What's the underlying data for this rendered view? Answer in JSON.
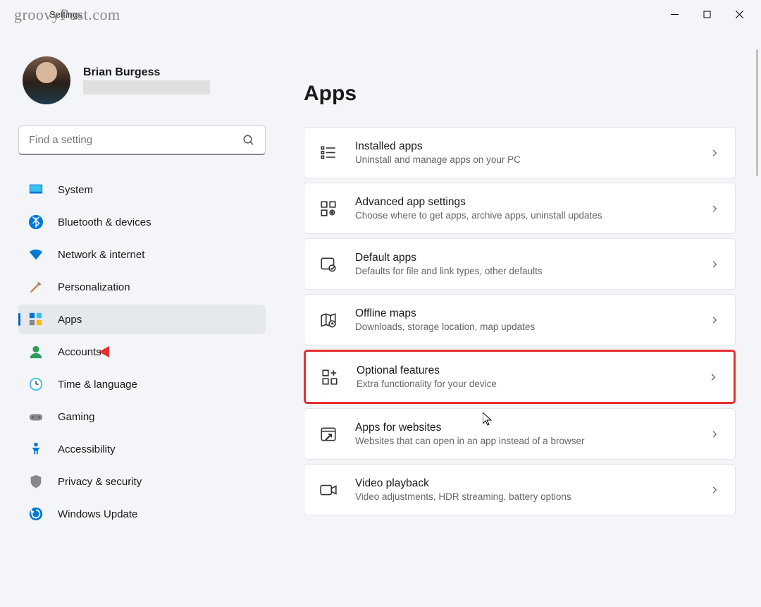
{
  "watermark": "groovyPost.com",
  "window": {
    "title": "Settings"
  },
  "profile": {
    "name": "Brian Burgess"
  },
  "search": {
    "placeholder": "Find a setting"
  },
  "sidebar": {
    "items": [
      {
        "label": "System",
        "icon": "system"
      },
      {
        "label": "Bluetooth & devices",
        "icon": "bluetooth"
      },
      {
        "label": "Network & internet",
        "icon": "wifi"
      },
      {
        "label": "Personalization",
        "icon": "brush"
      },
      {
        "label": "Apps",
        "icon": "apps",
        "active": true
      },
      {
        "label": "Accounts",
        "icon": "person"
      },
      {
        "label": "Time & language",
        "icon": "clock"
      },
      {
        "label": "Gaming",
        "icon": "gamepad"
      },
      {
        "label": "Accessibility",
        "icon": "accessibility"
      },
      {
        "label": "Privacy & security",
        "icon": "shield"
      },
      {
        "label": "Windows Update",
        "icon": "update"
      }
    ]
  },
  "page": {
    "title": "Apps"
  },
  "cards": [
    {
      "title": "Installed apps",
      "subtitle": "Uninstall and manage apps on your PC",
      "icon": "list"
    },
    {
      "title": "Advanced app settings",
      "subtitle": "Choose where to get apps, archive apps, uninstall updates",
      "icon": "apps-gear"
    },
    {
      "title": "Default apps",
      "subtitle": "Defaults for file and link types, other defaults",
      "icon": "default-apps"
    },
    {
      "title": "Offline maps",
      "subtitle": "Downloads, storage location, map updates",
      "icon": "map"
    },
    {
      "title": "Optional features",
      "subtitle": "Extra functionality for your device",
      "icon": "features",
      "highlighted": true
    },
    {
      "title": "Apps for websites",
      "subtitle": "Websites that can open in an app instead of a browser",
      "icon": "websites"
    },
    {
      "title": "Video playback",
      "subtitle": "Video adjustments, HDR streaming, battery options",
      "icon": "video"
    }
  ]
}
